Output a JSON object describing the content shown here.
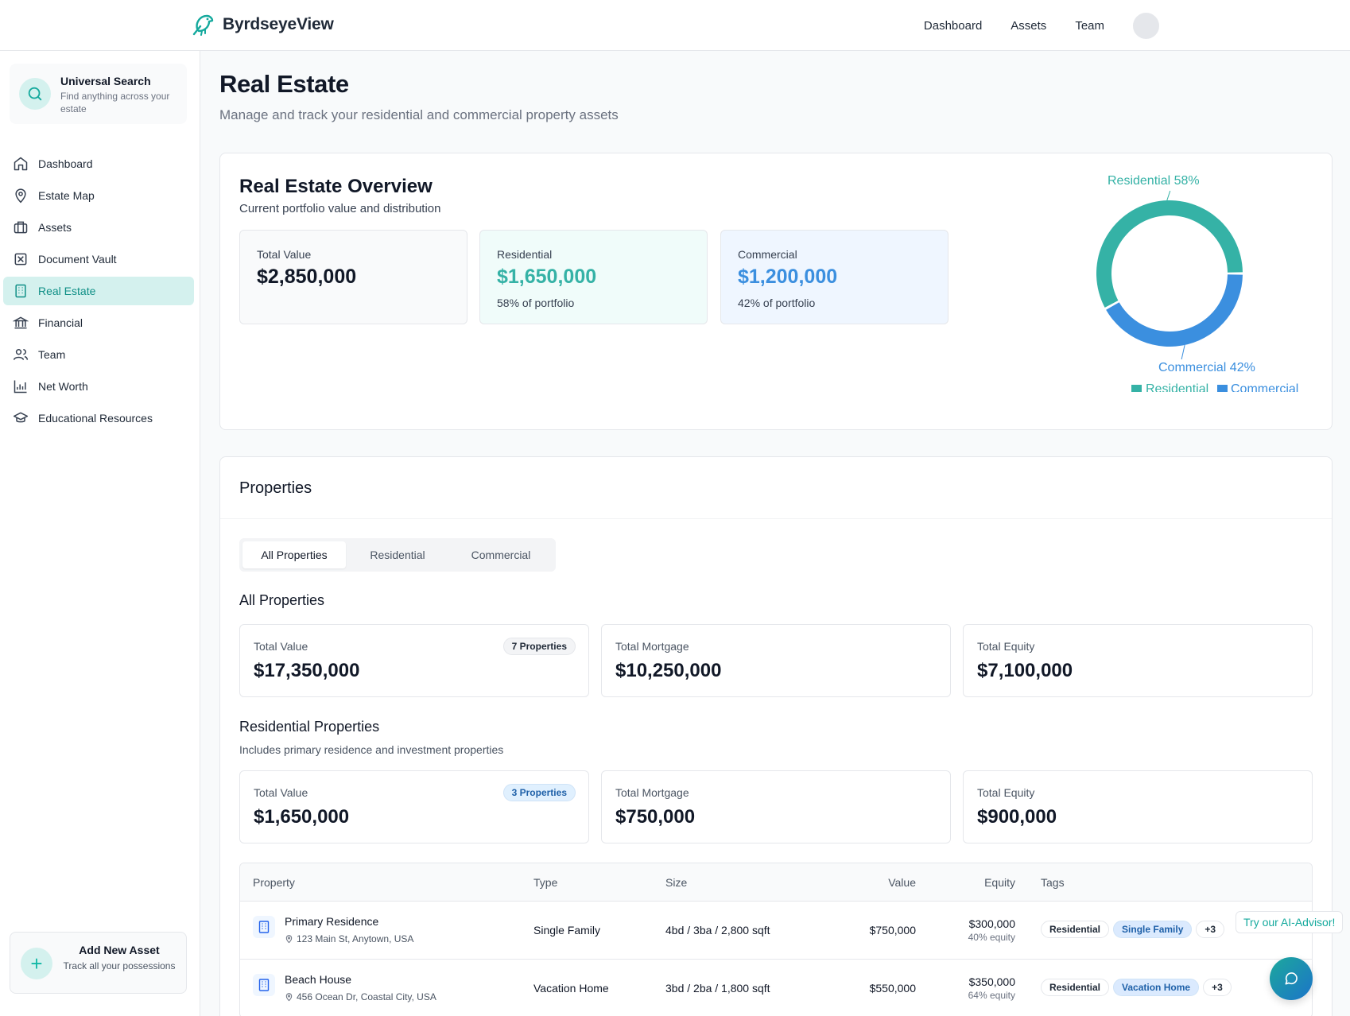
{
  "header": {
    "brand": "ByrdseyeView",
    "nav": [
      "Dashboard",
      "Assets",
      "Team"
    ]
  },
  "sidebar": {
    "search": {
      "title": "Universal Search",
      "subtitle": "Find anything across your estate"
    },
    "items": [
      {
        "label": "Dashboard",
        "icon": "home-icon"
      },
      {
        "label": "Estate Map",
        "icon": "map-pin-icon"
      },
      {
        "label": "Assets",
        "icon": "briefcase-icon"
      },
      {
        "label": "Document Vault",
        "icon": "vault-icon"
      },
      {
        "label": "Real Estate",
        "icon": "building-icon",
        "active": true
      },
      {
        "label": "Financial",
        "icon": "bank-icon"
      },
      {
        "label": "Team",
        "icon": "users-icon"
      },
      {
        "label": "Net Worth",
        "icon": "chart-icon"
      },
      {
        "label": "Educational Resources",
        "icon": "graduation-cap-icon"
      }
    ],
    "add": {
      "title": "Add New Asset",
      "subtitle": "Track all your possessions"
    }
  },
  "page": {
    "title": "Real Estate",
    "subtitle": "Manage and track your residential and commercial property assets"
  },
  "overview": {
    "title": "Real Estate Overview",
    "subtitle": "Current portfolio value and distribution",
    "total": {
      "label": "Total Value",
      "value": "$2,850,000"
    },
    "residential": {
      "label": "Residential",
      "value": "$1,650,000",
      "note": "58% of portfolio"
    },
    "commercial": {
      "label": "Commercial",
      "value": "$1,200,000",
      "note": "42% of portfolio"
    }
  },
  "chart_data": {
    "type": "pie",
    "categories": [
      "Residential",
      "Commercial"
    ],
    "values": [
      58,
      42
    ],
    "slice_labels": [
      "Residential 58%",
      "Commercial 42%"
    ],
    "colors": [
      "#35b2a6",
      "#3b8fdf"
    ],
    "legend": "bottom"
  },
  "properties": {
    "title": "Properties",
    "tabs": [
      "All Properties",
      "Residential",
      "Commercial"
    ],
    "all": {
      "title": "All Properties",
      "total_value": {
        "label": "Total Value",
        "value": "$17,350,000",
        "badge": "7 Properties"
      },
      "mortgage": {
        "label": "Total Mortgage",
        "value": "$10,250,000"
      },
      "equity": {
        "label": "Total Equity",
        "value": "$7,100,000"
      }
    },
    "residential": {
      "title": "Residential Properties",
      "subtitle": "Includes primary residence and investment properties",
      "total_value": {
        "label": "Total Value",
        "value": "$1,650,000",
        "badge": "3 Properties"
      },
      "mortgage": {
        "label": "Total Mortgage",
        "value": "$750,000"
      },
      "equity": {
        "label": "Total Equity",
        "value": "$900,000"
      }
    },
    "table": {
      "headers": [
        "Property",
        "Type",
        "Size",
        "Value",
        "Equity",
        "Tags"
      ],
      "rows": [
        {
          "name": "Primary Residence",
          "address": "123 Main St, Anytown, USA",
          "type": "Single Family",
          "size": "4bd / 3ba / 2,800 sqft",
          "value": "$750,000",
          "equity": "$300,000",
          "equity_pct": "40% equity",
          "tags": [
            "Residential",
            "Single Family",
            "+3"
          ]
        },
        {
          "name": "Beach House",
          "address": "456 Ocean Dr, Coastal City, USA",
          "type": "Vacation Home",
          "size": "3bd / 2ba / 1,800 sqft",
          "value": "$550,000",
          "equity": "$350,000",
          "equity_pct": "64% equity",
          "tags": [
            "Residential",
            "Vacation Home",
            "+3"
          ]
        }
      ]
    }
  },
  "ai": {
    "label": "Try our AI-Advisor!"
  },
  "colors": {
    "accent": "#14b8a6",
    "residential": "#35b2a6",
    "commercial": "#3b8fdf",
    "active_bg": "#d4f1ee"
  }
}
